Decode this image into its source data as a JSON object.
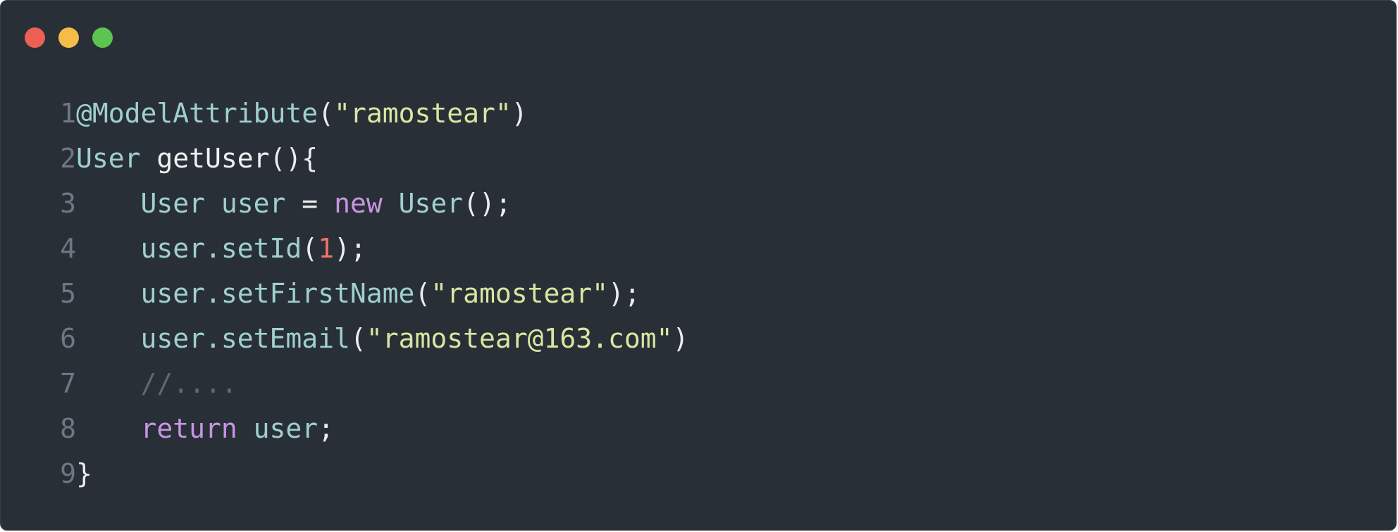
{
  "window": {
    "controls": [
      {
        "name": "close-dot",
        "color": "#ee5f56"
      },
      {
        "name": "minimize-dot",
        "color": "#f4bd4a"
      },
      {
        "name": "maximize-dot",
        "color": "#5cc44f"
      }
    ]
  },
  "colors": {
    "background": "#292f36",
    "line_number": "#6d7882",
    "annotation": "#9fd0ce",
    "type": "#9fd0ce",
    "plain": "#f0f0f0",
    "string": "#d9e6a2",
    "keyword": "#c795e3",
    "number": "#f07464",
    "comment": "#5d6873",
    "punct": "#ececec"
  },
  "code": {
    "lines": [
      {
        "number": "1",
        "tokens": [
          {
            "text": "@ModelAttribute",
            "kind": "annotation"
          },
          {
            "text": "(",
            "kind": "punct"
          },
          {
            "text": "\"ramostear\"",
            "kind": "string"
          },
          {
            "text": ")",
            "kind": "punct"
          }
        ]
      },
      {
        "number": "2",
        "tokens": [
          {
            "text": "User",
            "kind": "type"
          },
          {
            "text": " getUser",
            "kind": "plain"
          },
          {
            "text": "(){",
            "kind": "punct"
          }
        ]
      },
      {
        "number": "3",
        "tokens": [
          {
            "text": "    User user ",
            "kind": "type"
          },
          {
            "text": "= ",
            "kind": "punct"
          },
          {
            "text": "new",
            "kind": "keyword"
          },
          {
            "text": " User",
            "kind": "type"
          },
          {
            "text": "();",
            "kind": "punct"
          }
        ]
      },
      {
        "number": "4",
        "tokens": [
          {
            "text": "    user.setId",
            "kind": "type"
          },
          {
            "text": "(",
            "kind": "punct"
          },
          {
            "text": "1",
            "kind": "number"
          },
          {
            "text": ");",
            "kind": "punct"
          }
        ]
      },
      {
        "number": "5",
        "tokens": [
          {
            "text": "    user.setFirstName",
            "kind": "type"
          },
          {
            "text": "(",
            "kind": "punct"
          },
          {
            "text": "\"ramostear\"",
            "kind": "string"
          },
          {
            "text": ");",
            "kind": "punct"
          }
        ]
      },
      {
        "number": "6",
        "tokens": [
          {
            "text": "    user.setEmail",
            "kind": "type"
          },
          {
            "text": "(",
            "kind": "punct"
          },
          {
            "text": "\"ramostear@163.com\"",
            "kind": "string"
          },
          {
            "text": ")",
            "kind": "punct"
          }
        ]
      },
      {
        "number": "7",
        "tokens": [
          {
            "text": "    //....",
            "kind": "comment"
          }
        ]
      },
      {
        "number": "8",
        "tokens": [
          {
            "text": "    ",
            "kind": "plain"
          },
          {
            "text": "return",
            "kind": "keyword"
          },
          {
            "text": " user",
            "kind": "type"
          },
          {
            "text": ";",
            "kind": "punct"
          }
        ]
      },
      {
        "number": "9",
        "tokens": [
          {
            "text": "}",
            "kind": "punct"
          }
        ]
      }
    ]
  }
}
